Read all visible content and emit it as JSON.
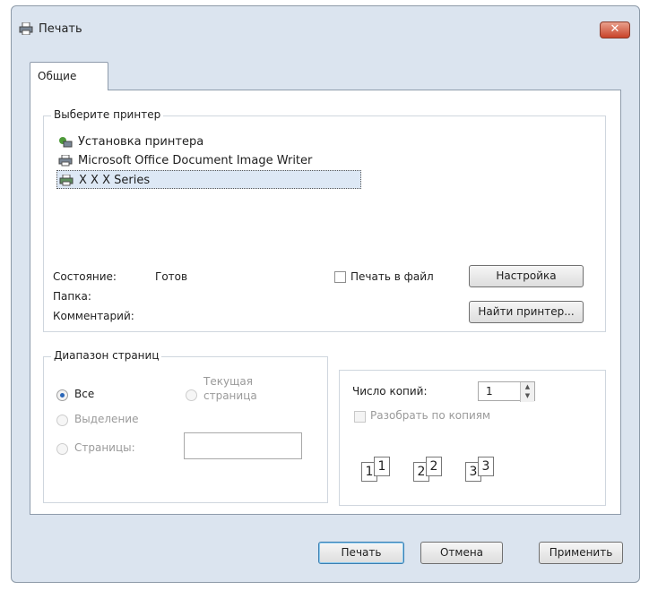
{
  "window": {
    "title": "Печать",
    "close_label": "✕"
  },
  "tabs": [
    {
      "label": "Общие"
    }
  ],
  "printer_group": {
    "legend": "Выберите принтер",
    "printers": [
      {
        "label": "Установка принтера",
        "icon": "add-printer-icon"
      },
      {
        "label": "Microsoft Office Document Image Writer",
        "icon": "printer-icon"
      },
      {
        "label": "X X X Series",
        "icon": "printer-icon",
        "selected": true
      }
    ],
    "status_label": "Состояние:",
    "status_value": "Готов",
    "folder_label": "Папка:",
    "comment_label": "Комментарий:",
    "print_to_file_label": "Печать в файл",
    "settings_button": "Настройка",
    "find_printer_button": "Найти принтер..."
  },
  "range_group": {
    "legend": "Диапазон страниц",
    "all_label": "Все",
    "selection_label": "Выделение",
    "current_page_label_1": "Текущая",
    "current_page_label_2": "страница",
    "pages_label": "Страницы:",
    "pages_value": ""
  },
  "copies_group": {
    "copies_label": "Число копий:",
    "copies_value": "1",
    "collate_label": "Разобрать по копиям",
    "collate_pages": [
      "1",
      "1",
      "2",
      "2",
      "3",
      "3"
    ]
  },
  "buttons": {
    "print": "Печать",
    "cancel": "Отмена",
    "apply": "Применить"
  }
}
